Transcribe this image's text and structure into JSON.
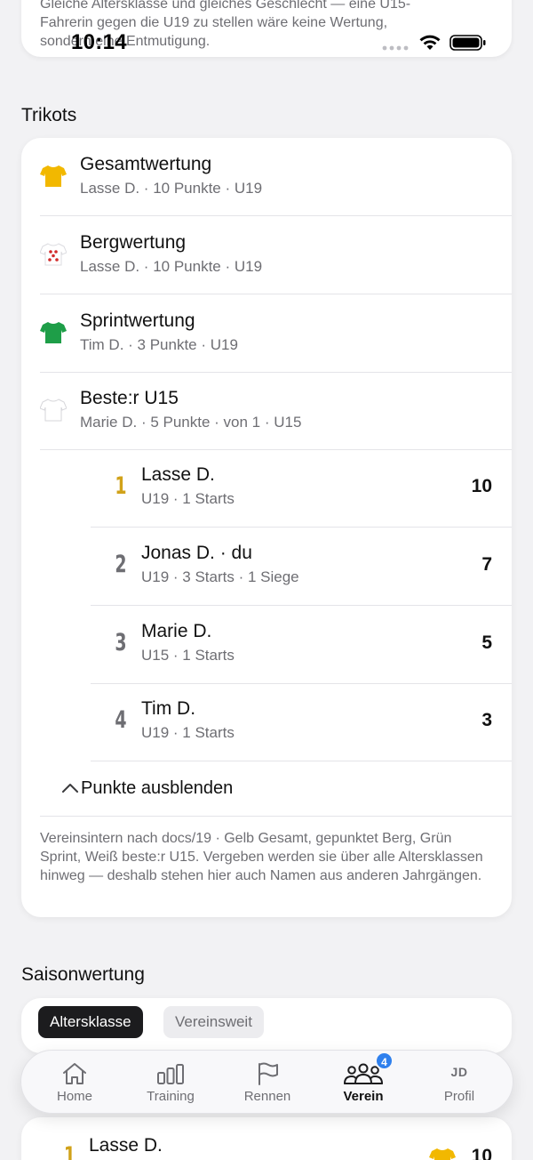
{
  "status_bar": {
    "time": "10:14"
  },
  "top_card": {
    "lines": [
      "Gleiche Altersklasse und gleiches Geschlecht — eine U15-",
      "Fahrerin gegen die U19 zu stellen wäre keine Wertung,",
      "sondern eine Entmutigung."
    ]
  },
  "trikots": {
    "title": "Trikots",
    "jerseys": [
      {
        "name": "Gesamtwertung",
        "meta": "Lasse D. · 10 Punkte · U19",
        "icon": "yellow-jersey-icon",
        "color": "#f2b800"
      },
      {
        "name": "Bergwertung",
        "meta": "Lasse D. · 10 Punkte · U19",
        "icon": "polka-dot-jersey-icon",
        "color": "#d22a2a"
      },
      {
        "name": "Sprintwertung",
        "meta": "Tim D. · 3 Punkte · U19",
        "icon": "green-jersey-icon",
        "color": "#1e9e48"
      },
      {
        "name": "Beste:r U15",
        "meta": "Marie D. · 5 Punkte · von 1 · U15",
        "icon": "white-jersey-icon",
        "color": "#ffffff"
      }
    ],
    "standings": [
      {
        "rank": "1",
        "name": "Lasse D.",
        "meta": "U19 · 1 Starts",
        "points": "10"
      },
      {
        "rank": "2",
        "name": "Jonas D. · du",
        "meta": "U19 · 3 Starts · 1 Siege",
        "points": "7"
      },
      {
        "rank": "3",
        "name": "Marie D.",
        "meta": "U15 · 1 Starts",
        "points": "5"
      },
      {
        "rank": "4",
        "name": "Tim D.",
        "meta": "U19 · 1 Starts",
        "points": "3"
      }
    ],
    "toggle_label": "Punkte ausblenden",
    "note": "Vereinsintern nach docs/19 · Gelb Gesamt, gepunktet Berg, Grün Sprint, Weiß beste:r U15. Vergeben werden sie über alle Altersklassen hinweg — deshalb stehen hier auch Namen aus anderen Jahrgängen."
  },
  "saison": {
    "title": "Saisonwertung",
    "segments": [
      "Altersklasse",
      "Vereinsweit"
    ],
    "first_row": {
      "rank": "1",
      "name": "Lasse D.",
      "points": "10"
    }
  },
  "tabbar": {
    "tabs": [
      {
        "label": "Home",
        "icon": "home-icon"
      },
      {
        "label": "Training",
        "icon": "bar-chart-icon"
      },
      {
        "label": "Rennen",
        "icon": "flag-icon"
      },
      {
        "label": "Verein",
        "icon": "group-icon",
        "badge": "4"
      },
      {
        "label": "Profil",
        "initials": "JD"
      }
    ],
    "active": "Verein"
  },
  "colors": {
    "gold": "#d1a21a",
    "accent": "#2f80ed",
    "dark": "#1c1c1e"
  }
}
